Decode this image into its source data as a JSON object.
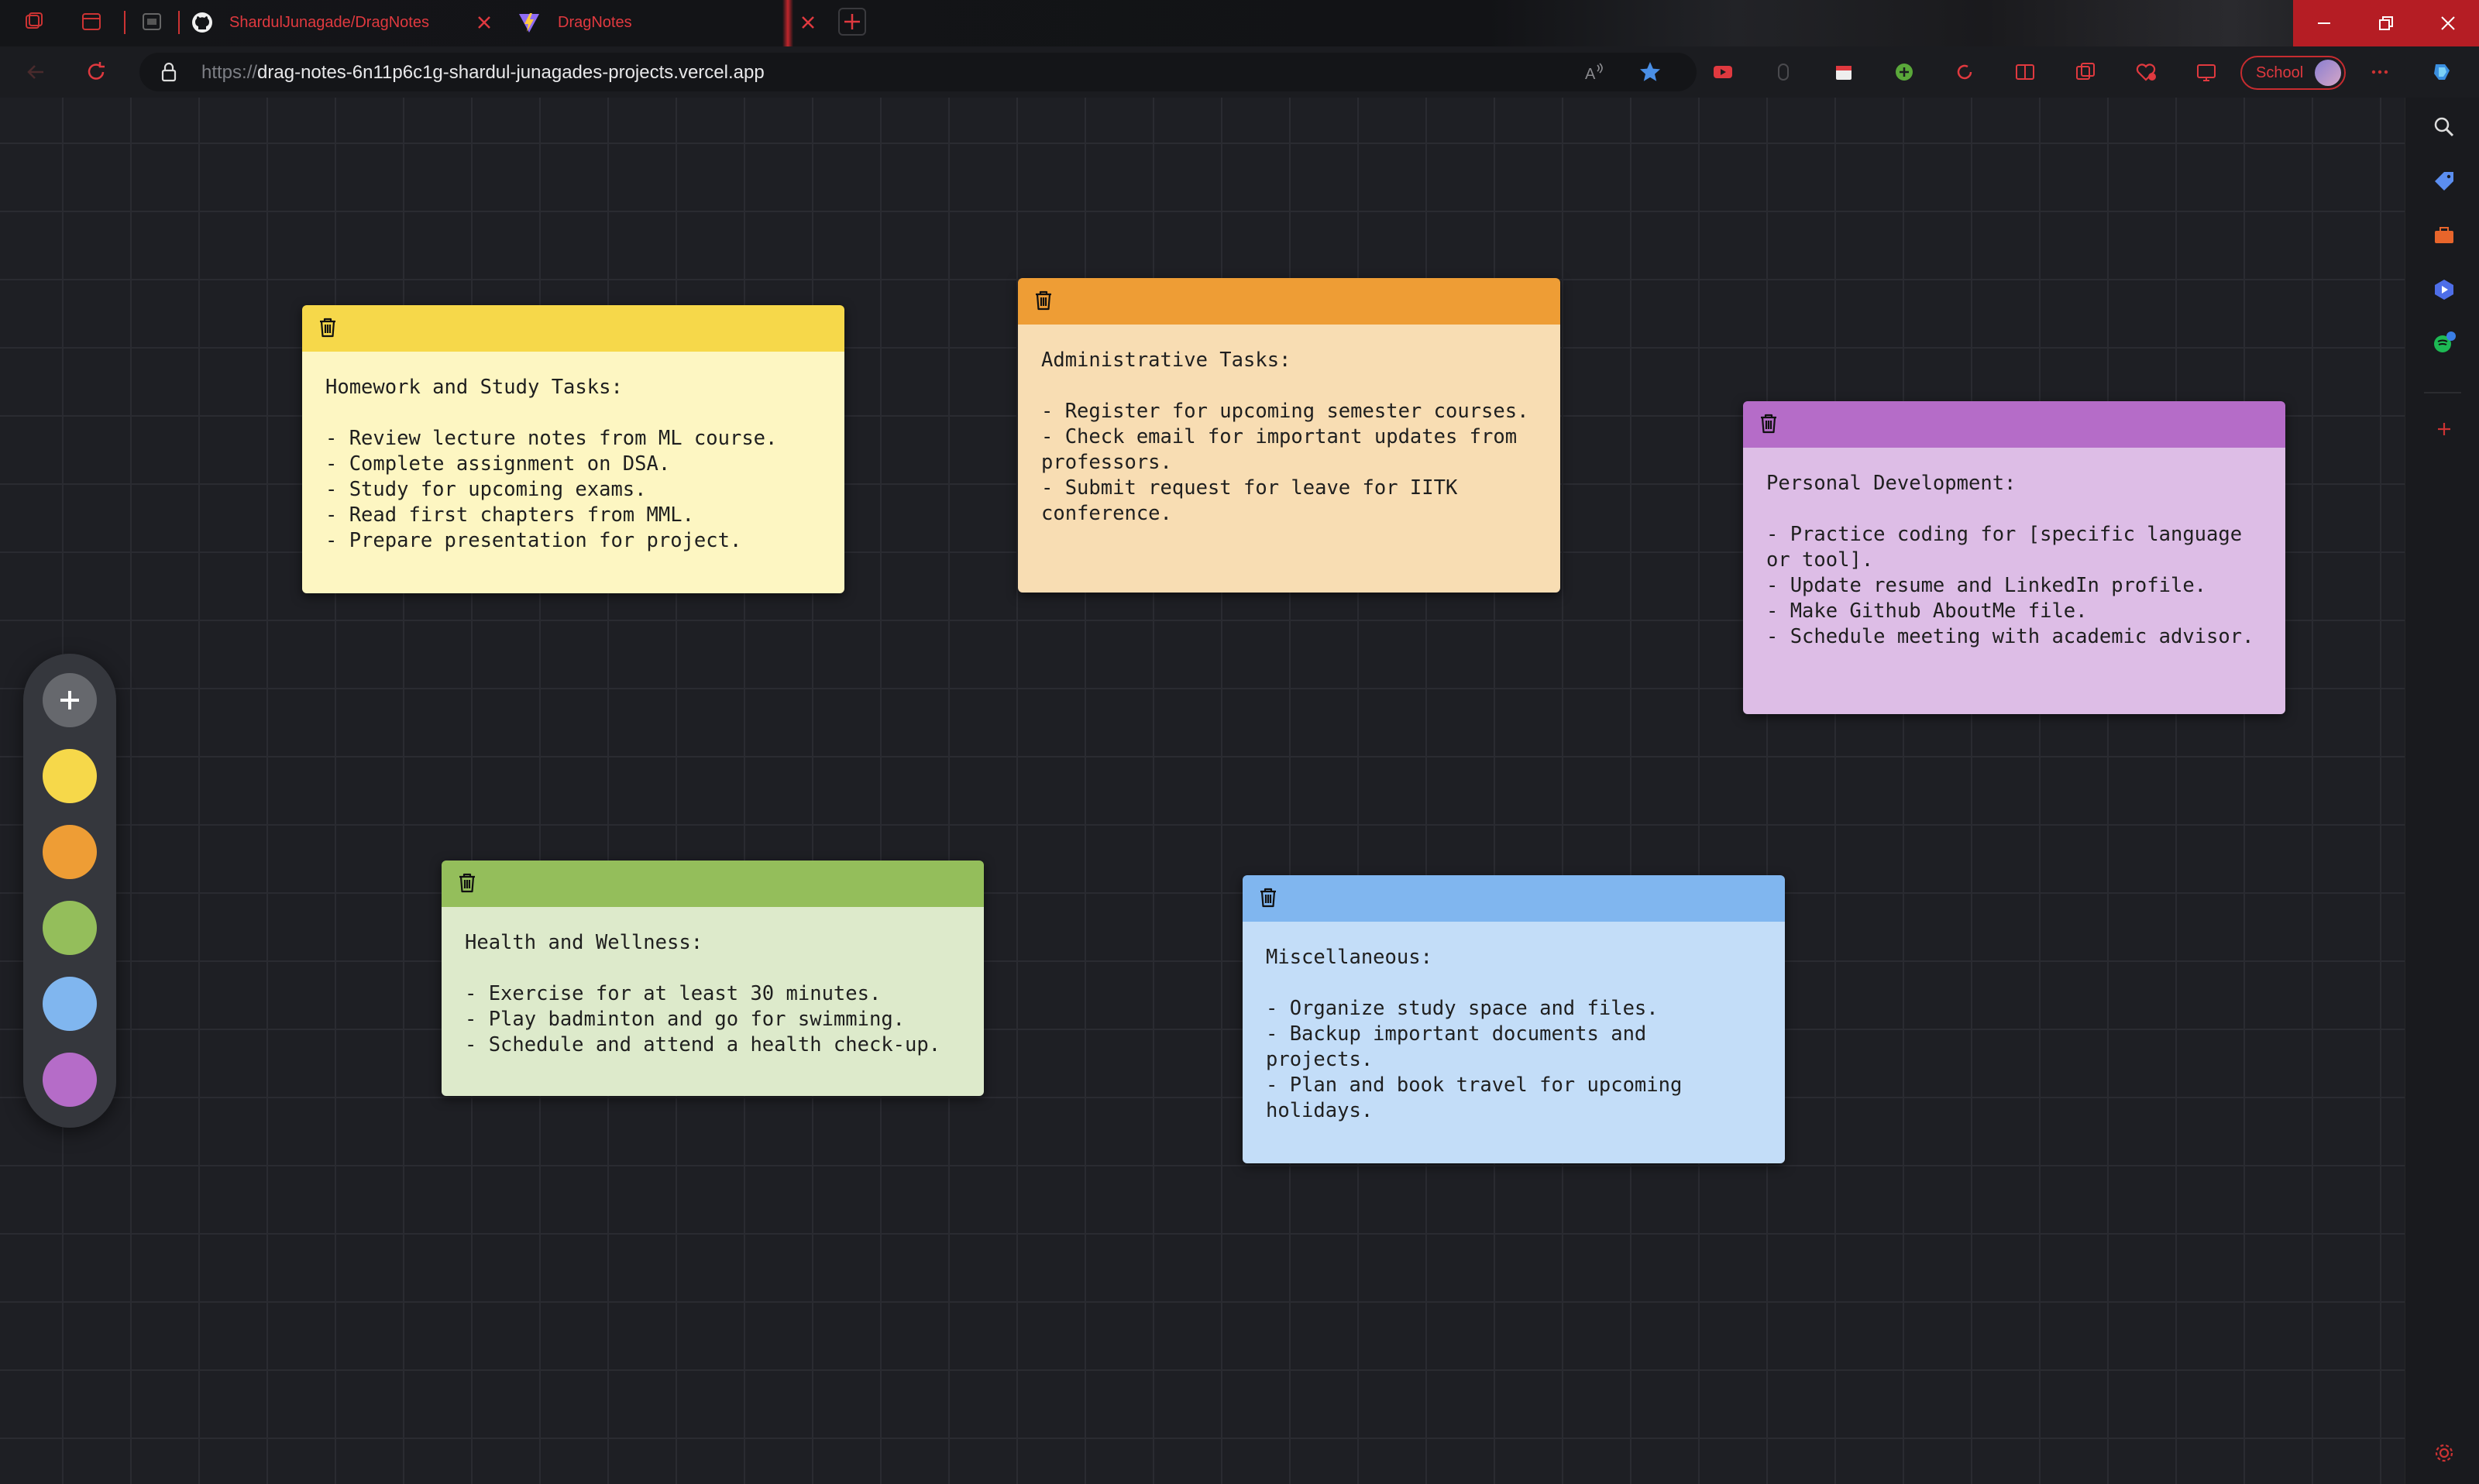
{
  "browser": {
    "tabs": [
      {
        "title": "ShardulJunagade/DragNotes",
        "favicon": "github-icon"
      },
      {
        "title": "DragNotes",
        "favicon": "vite-icon"
      }
    ],
    "url_prefix": "https://",
    "url_host": "drag-notes-6n11p6c1g-shardul-junagades-projects.vercel.app",
    "profile_label": "School",
    "accent_color": "#e0393f"
  },
  "palette": {
    "add_label": "+",
    "colors": [
      {
        "name": "yellow",
        "hex": "#f6d84a"
      },
      {
        "name": "orange",
        "hex": "#ee9d35"
      },
      {
        "name": "green",
        "hex": "#94be5b"
      },
      {
        "name": "blue",
        "hex": "#80b6ef"
      },
      {
        "name": "purple",
        "hex": "#b56cc8"
      }
    ]
  },
  "notes": [
    {
      "id": "yellow",
      "header_color": "#f6d84a",
      "body_color": "#fdf6c2",
      "text": "Homework and Study Tasks:\n\n- Review lecture notes from ML course.\n- Complete assignment on DSA.\n- Study for upcoming exams.\n- Read first chapters from MML.\n- Prepare presentation for project."
    },
    {
      "id": "orange",
      "header_color": "#ee9d35",
      "body_color": "#f8ddb3",
      "text": "Administrative Tasks:\n\n- Register for upcoming semester courses.\n- Check email for important updates from professors.\n- Submit request for leave for IITK conference."
    },
    {
      "id": "purple",
      "header_color": "#b56cc8",
      "body_color": "#ddbde6",
      "text": "Personal Development:\n\n- Practice coding for [specific language or tool].\n- Update resume and LinkedIn profile.\n- Make Github AboutMe file.\n- Schedule meeting with academic advisor."
    },
    {
      "id": "green",
      "header_color": "#94be5b",
      "body_color": "#ddeacb",
      "text": "Health and Wellness:\n\n- Exercise for at least 30 minutes.\n- Play badminton and go for swimming.\n- Schedule and attend a health check-up."
    },
    {
      "id": "blue",
      "header_color": "#80b6ef",
      "body_color": "#c3ddf8",
      "text": "Miscellaneous:\n\n- Organize study space and files.\n- Backup important documents and projects.\n- Plan and book travel for upcoming holidays."
    }
  ]
}
